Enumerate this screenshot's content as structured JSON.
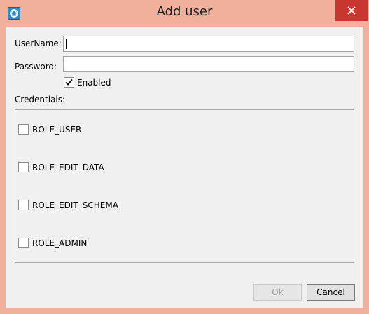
{
  "window": {
    "title": "Add user",
    "app_icon": "app-logo-icon",
    "close_icon": "close-icon"
  },
  "form": {
    "username_label": "UserName:",
    "username_value": "",
    "password_label": "Password:",
    "password_value": "",
    "enabled_label": "Enabled",
    "enabled_checked": true,
    "credentials_label": "Credentials:"
  },
  "credentials": [
    {
      "label": "ROLE_USER",
      "checked": false
    },
    {
      "label": "ROLE_EDIT_DATA",
      "checked": false
    },
    {
      "label": "ROLE_EDIT_SCHEMA",
      "checked": false
    },
    {
      "label": "ROLE_ADMIN",
      "checked": false
    }
  ],
  "buttons": {
    "ok_label": "Ok",
    "ok_enabled": false,
    "cancel_label": "Cancel"
  },
  "colors": {
    "titlebar": "#f1b09c",
    "close_button": "#c7372f",
    "client_background": "#f0f0f0"
  }
}
